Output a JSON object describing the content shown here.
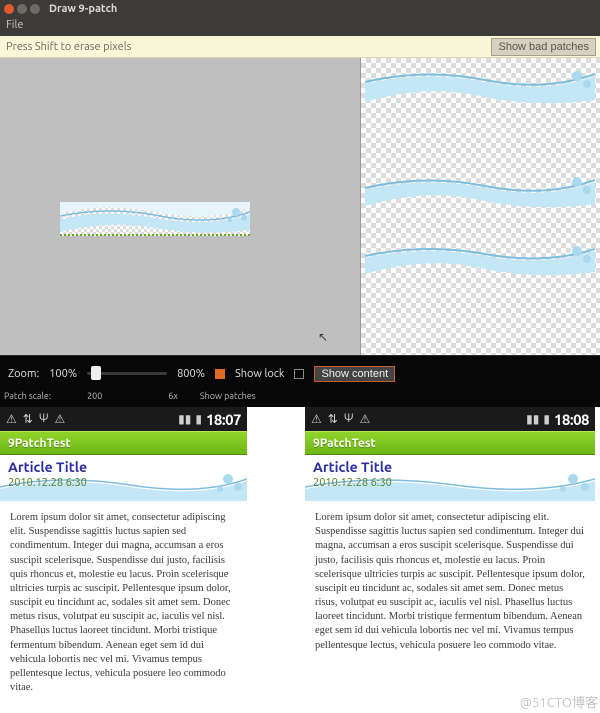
{
  "window": {
    "title": "Draw 9-patch",
    "menu": {
      "file": "File"
    },
    "hint": "Press Shift to erase pixels",
    "bad_patches_btn": "Show bad patches"
  },
  "controls": {
    "zoom_label": "Zoom:",
    "zoom_min": "100%",
    "zoom_max": "800%",
    "zoom_tick": "200",
    "show_lock": "Show lock",
    "show_content": "Show content",
    "patch_scale_label": "Patch scale:",
    "patch_scale_max": "6x",
    "show_patches": "Show patches"
  },
  "phones": [
    {
      "time": "18:07",
      "app_title": "9PatchTest",
      "article_title": "Article Title",
      "article_date": "2010.12.28 6:30",
      "body": "Lorem ipsum dolor sit amet, consectetur adipiscing elit. Suspendisse sagittis luctus sapien sed condimentum. Integer dui magna, accumsan a eros suscipit scelerisque. Suspendisse dui justo, facilisis quis rhoncus et, molestie eu lacus. Proin scelerisque ultricies turpis ac suscipit. Pellentesque ipsum dolor, suscipit eu tincidunt ac, sodales sit amet sem. Donec metus risus, volutpat eu suscipit ac, iaculis vel nisl. Phasellus luctus laoreet tincidunt. Morbi tristique fermentum bibendum. Aenean eget sem id dui vehicula lobortis nec vel mi. Vivamus tempus pellentesque lectus, vehicula posuere leo commodo vitae."
    },
    {
      "time": "18:08",
      "app_title": "9PatchTest",
      "article_title": "Article Title",
      "article_date": "2010.12.28 6:30",
      "body": "Lorem ipsum dolor sit amet, consectetur adipiscing elit. Suspendisse sagittis luctus sapien sed condimentum. Integer dui magna, accumsan a eros suscipit scelerisque. Suspendisse dui justo, facilisis quis rhoncus et, molestie eu lacus. Proin scelerisque ultricies turpis ac suscipit. Pellentesque ipsum dolor, suscipit eu tincidunt ac, sodales sit amet sem. Donec metus risus, volutpat eu suscipit ac, iaculis vel nisl. Phasellus luctus laoreet tincidunt. Morbi tristique fermentum bibendum. Aenean eget sem id dui vehicula lobortis nec vel mi. Vivamus tempus pellentesque lectus, vehicula posuere leo commodo vitae."
    }
  ],
  "watermark": "@51CTO博客"
}
